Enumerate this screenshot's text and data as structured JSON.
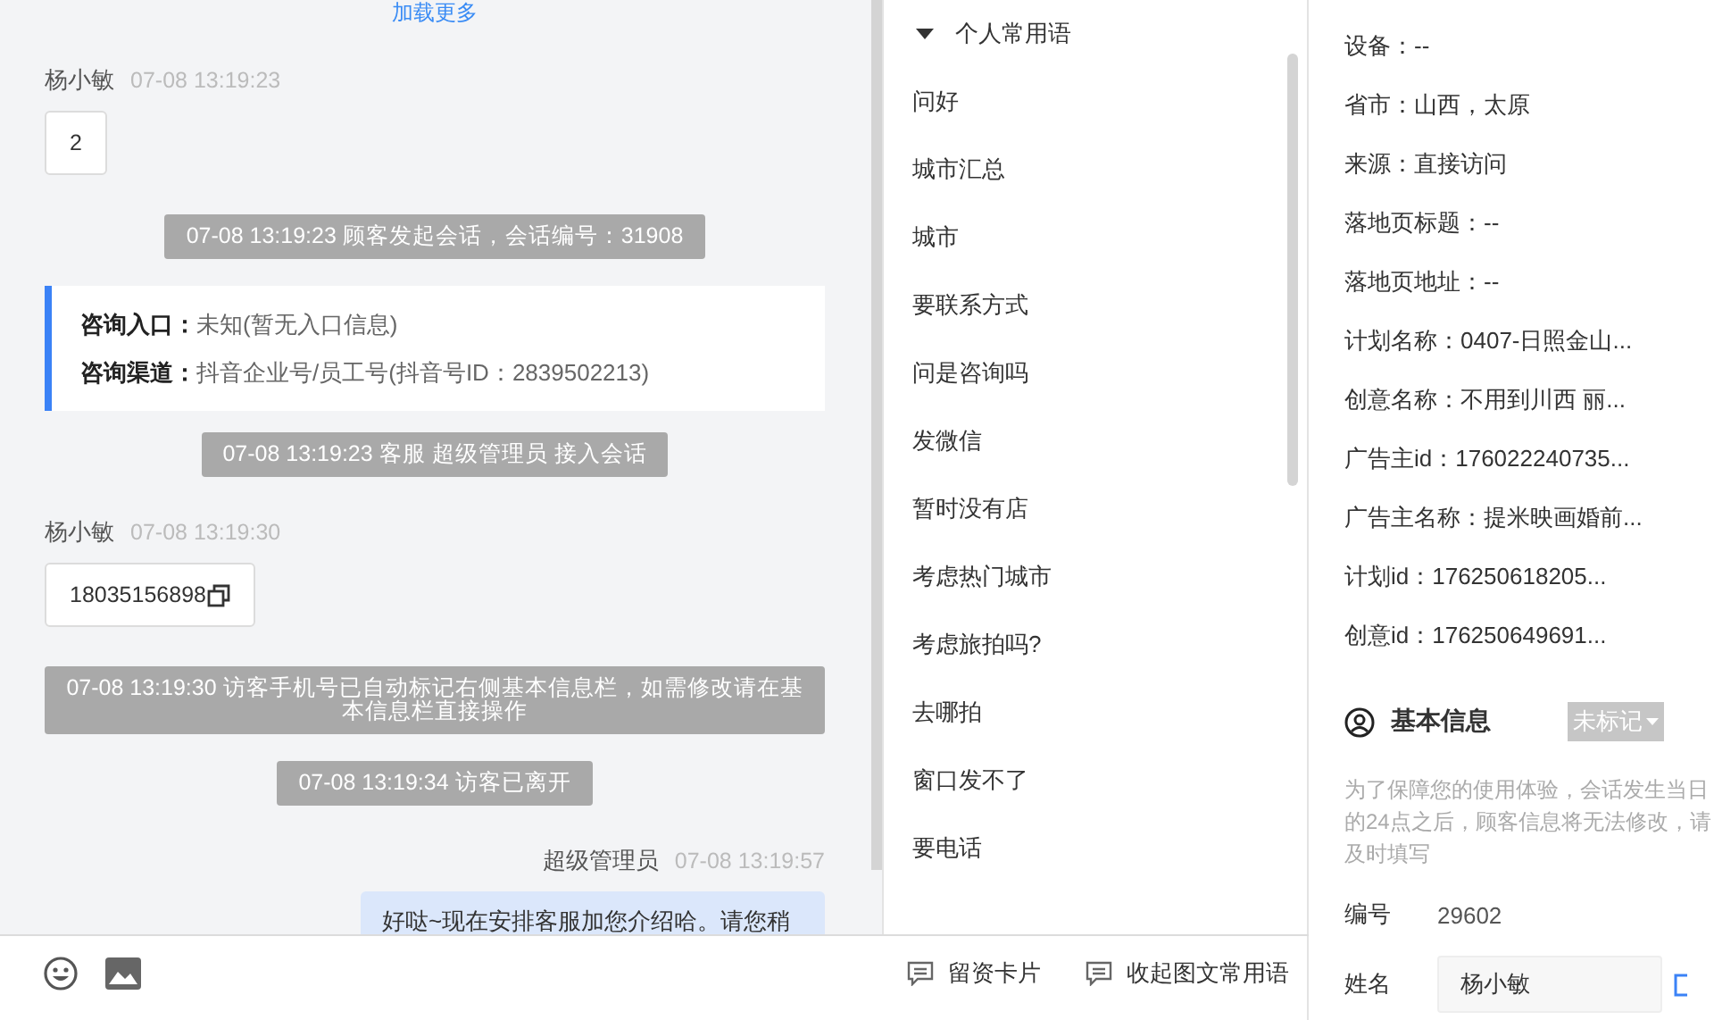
{
  "chat": {
    "load_more": "加载更多",
    "messages": [
      {
        "kind": "visitor",
        "name": "杨小敏",
        "time": "07-08 13:19:23",
        "text": "2",
        "copyable": false
      },
      {
        "kind": "system",
        "text": "07-08 13:19:23 顾客发起会话，会话编号：31908"
      },
      {
        "kind": "entry_card",
        "fields": [
          {
            "label": "咨询入口：",
            "value": "未知(暂无入口信息)"
          },
          {
            "label": "咨询渠道：",
            "value": "抖音企业号/员工号(抖音号ID：2839502213)"
          }
        ]
      },
      {
        "kind": "system",
        "text": "07-08 13:19:23 客服 超级管理员 接入会话"
      },
      {
        "kind": "visitor",
        "name": "杨小敏",
        "time": "07-08 13:19:30",
        "text": "18035156898",
        "copyable": true
      },
      {
        "kind": "system",
        "text": "07-08 13:19:30 访客手机号已自动标记右侧基本信息栏，如需修改请在基本信息栏直接操作"
      },
      {
        "kind": "system",
        "text": "07-08 13:19:34 访客已离开"
      },
      {
        "kind": "agent",
        "name": "超级管理员",
        "time": "07-08 13:19:57",
        "text": "好哒~现在安排客服加您介绍哈。请您稍"
      }
    ]
  },
  "phrases": {
    "group": {
      "label": "个人常用语",
      "expanded": true
    },
    "items": [
      "问好",
      "城市汇总",
      "城市",
      "要联系方式",
      "问是咨询吗",
      "发微信",
      "暂时没有店",
      "考虑热门城市",
      "考虑旅拍吗?",
      "去哪拍",
      "窗口发不了",
      "要电话"
    ]
  },
  "toolbar": {
    "buttons": [
      "留资卡片",
      "收起图文常用语"
    ]
  },
  "visitor_info": {
    "rows": [
      "设备：--",
      "省市：山西，太原",
      "来源：直接访问",
      "落地页标题：--",
      "落地页地址：--",
      "计划名称：0407-日照金山...",
      "创意名称：不用到川西 丽...",
      "广告主id：176022240735...",
      "广告主名称：提米映画婚前...",
      "计划id：176250618205...",
      "创意id：176250649691..."
    ]
  },
  "basic_info": {
    "title": "基本信息",
    "tag": "未标记",
    "notice": "为了保障您的使用体验，会话发生当日的24点之后，顾客信息将无法修改，请及时填写",
    "fields": [
      {
        "kind": "text",
        "label": "编号",
        "value": "29602"
      },
      {
        "kind": "input",
        "label": "姓名",
        "value": "杨小敏"
      }
    ]
  }
}
